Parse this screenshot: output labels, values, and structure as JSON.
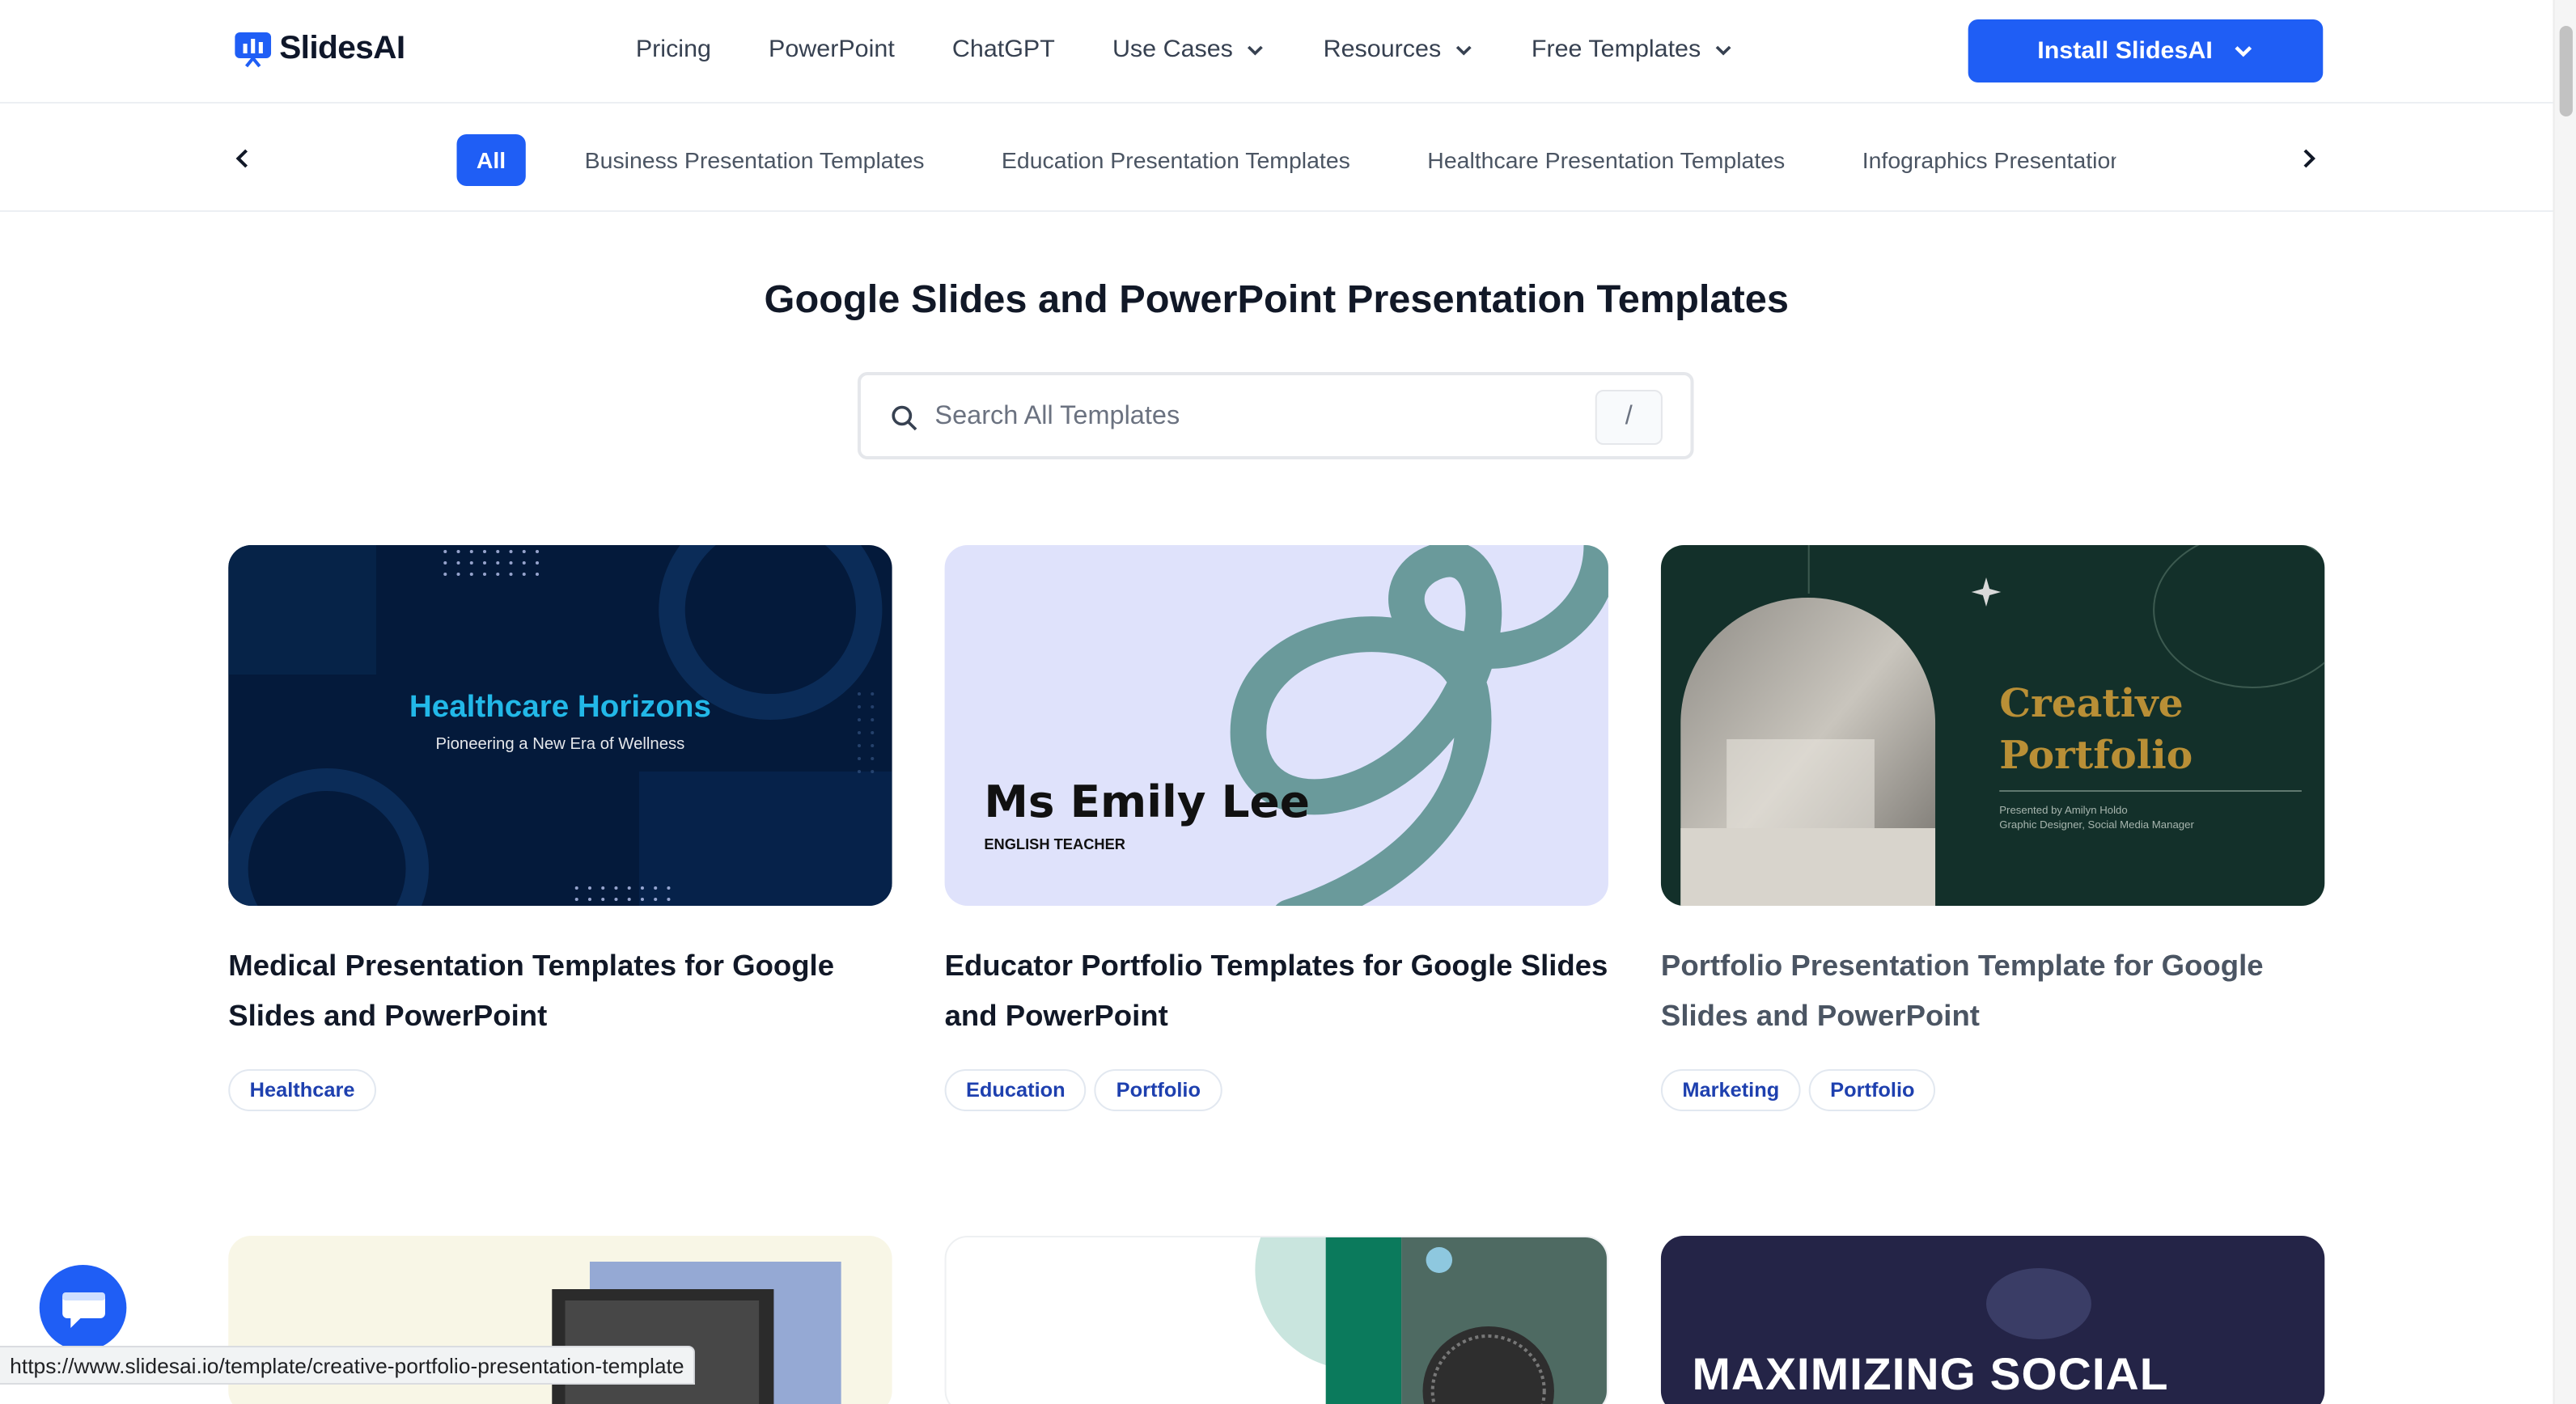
{
  "header": {
    "logo_text": "SlidesAI",
    "nav": [
      {
        "label": "Pricing",
        "dropdown": false
      },
      {
        "label": "PowerPoint",
        "dropdown": false
      },
      {
        "label": "ChatGPT",
        "dropdown": false
      },
      {
        "label": "Use Cases",
        "dropdown": true
      },
      {
        "label": "Resources",
        "dropdown": true
      },
      {
        "label": "Free Templates",
        "dropdown": true
      }
    ],
    "install_label": "Install SlidesAI"
  },
  "categories": {
    "active": "All",
    "items": [
      "Business Presentation Templates",
      "Education Presentation Templates",
      "Healthcare Presentation Templates",
      "Infographics Presentation Templates"
    ]
  },
  "page_title": "Google Slides and PowerPoint Presentation Templates",
  "search": {
    "placeholder": "Search All Templates",
    "shortcut": "/"
  },
  "cards": [
    {
      "title": "Medical Presentation Templates for Google Slides and PowerPoint",
      "thumb_heading": "Healthcare Horizons",
      "thumb_sub": "Pioneering a New Era of Wellness",
      "tags": [
        "Healthcare"
      ]
    },
    {
      "title": "Educator Portfolio Templates for Google Slides and PowerPoint",
      "thumb_heading": "Ms Emily Lee",
      "thumb_sub": "ENGLISH TEACHER",
      "tags": [
        "Education",
        "Portfolio"
      ]
    },
    {
      "title": "Portfolio Presentation Template for Google Slides and PowerPoint",
      "thumb_heading_1": "Creative",
      "thumb_heading_2": "Portfolio",
      "thumb_sub_1": "Presented by Amilyn Holdo",
      "thumb_sub_2": "Graphic Designer, Social Media Manager",
      "tags": [
        "Marketing",
        "Portfolio"
      ]
    }
  ],
  "row2": {
    "card6_heading": "MAXIMIZING SOCIAL"
  },
  "status_url": "https://www.slidesai.io/template/creative-portfolio-presentation-template",
  "colors": {
    "primary": "#1f5ef5",
    "tag_text": "#1e40af"
  }
}
